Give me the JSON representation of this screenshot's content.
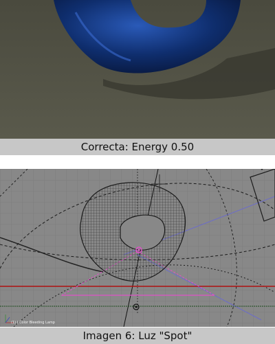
{
  "figures": [
    {
      "caption": "Correcta: Energy 0.50"
    },
    {
      "caption": "Imagen 6: Luz \"Spot\"",
      "viewport_label": "(1) | Color Bleeding Lamp"
    }
  ],
  "colors": {
    "render_background": "#4b4a40",
    "object_blue": "#0d2a66",
    "viewport_background": "#888888",
    "caption_bar": "#c7c7c7",
    "spot_light": "#e052c8",
    "floor_line": "#b01010"
  }
}
